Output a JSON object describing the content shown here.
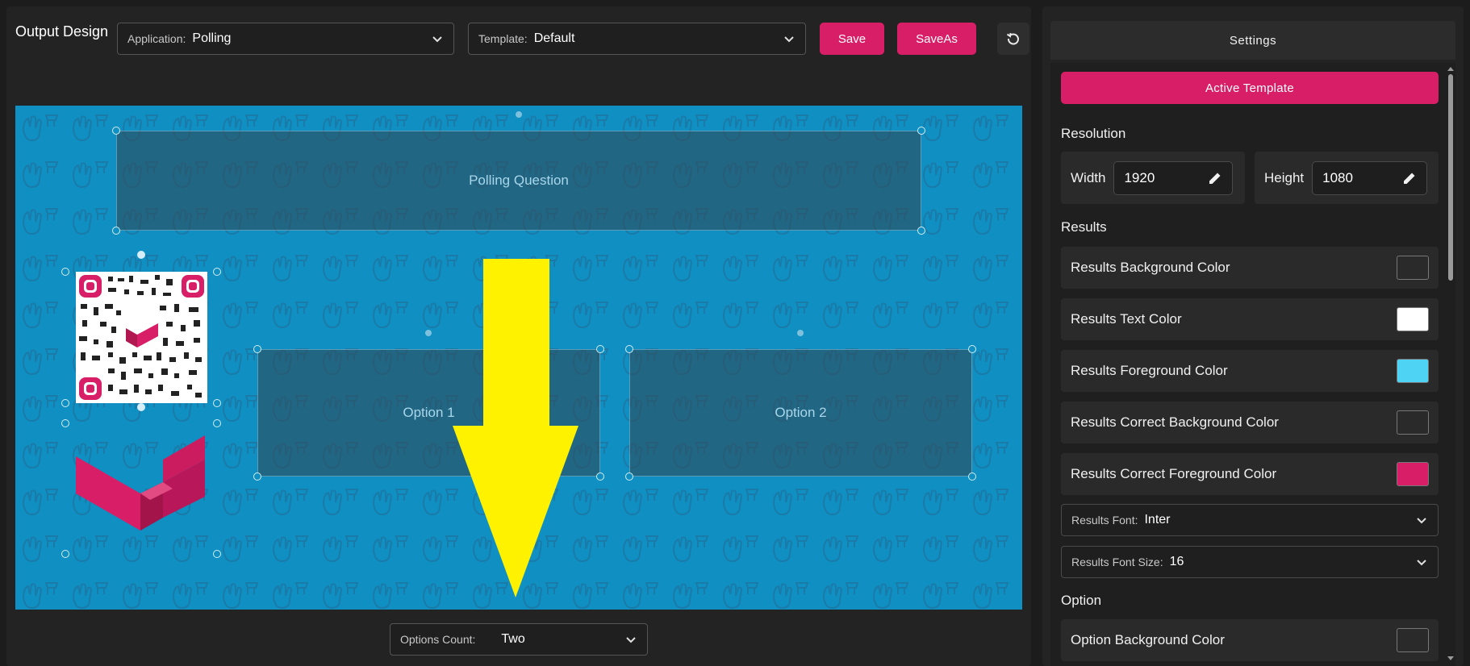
{
  "header": {
    "title": "Output Design",
    "application": {
      "label": "Application:",
      "value": "Polling"
    },
    "template": {
      "label": "Template:",
      "value": "Default"
    },
    "save_label": "Save",
    "save_as_label": "SaveAs"
  },
  "canvas": {
    "question_label": "Polling Question",
    "option1_label": "Option 1",
    "option2_label": "Option 2",
    "background_color": "#0f8fc2",
    "annotation_arrow_color": "#fff200"
  },
  "options_count": {
    "label": "Options Count:",
    "value": "Two"
  },
  "settings": {
    "title": "Settings",
    "active_template_label": "Active Template",
    "resolution": {
      "title": "Resolution",
      "width_label": "Width",
      "width_value": "1920",
      "height_label": "Height",
      "height_value": "1080"
    },
    "results": {
      "title": "Results",
      "rows": [
        {
          "label": "Results Background Color",
          "color": "#2a2a2a"
        },
        {
          "label": "Results Text Color",
          "color": "#ffffff"
        },
        {
          "label": "Results Foreground Color",
          "color": "#4fd3f5"
        },
        {
          "label": "Results Correct Background Color",
          "color": "#2a2a2a"
        },
        {
          "label": "Results Correct Foreground Color",
          "color": "#d81e66"
        }
      ],
      "font": {
        "label": "Results Font:",
        "value": "Inter"
      },
      "font_size": {
        "label": "Results Font Size:",
        "value": "16"
      }
    },
    "option": {
      "title": "Option",
      "rows": [
        {
          "label": "Option Background Color",
          "color": "#2a2a2a"
        }
      ]
    }
  },
  "colors": {
    "accent": "#d81e66"
  }
}
